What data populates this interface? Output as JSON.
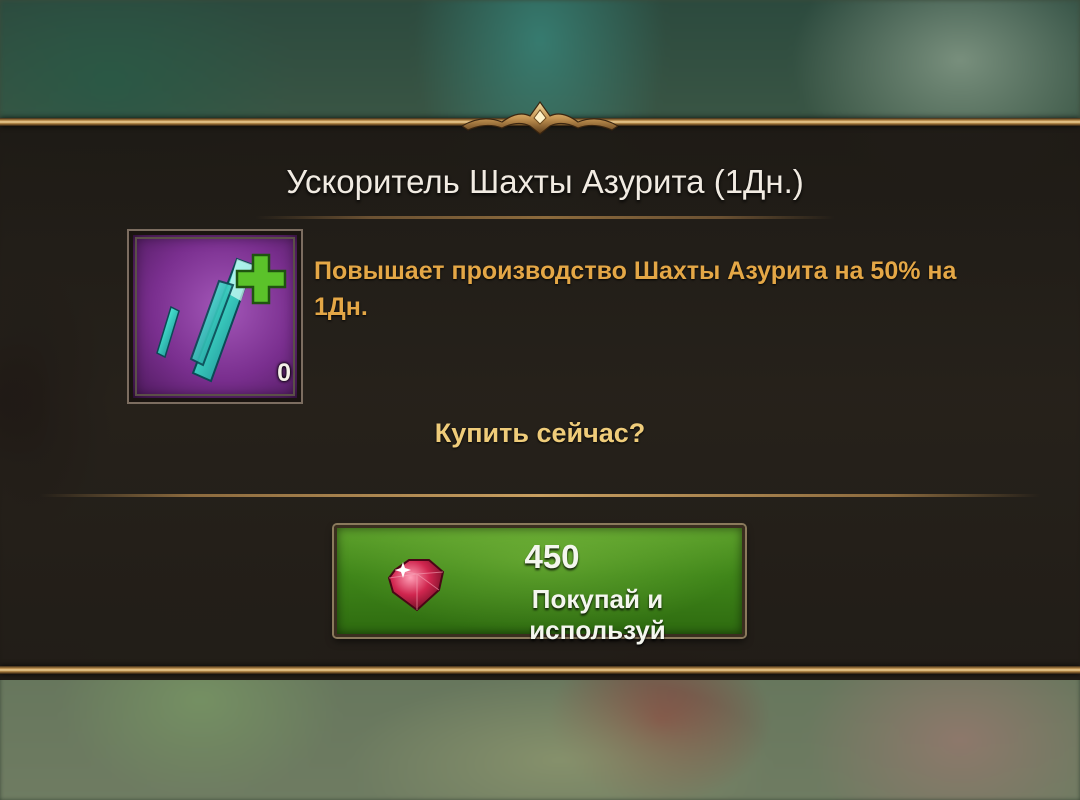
{
  "dialog": {
    "title": "Ускоритель Шахты Азурита (1Дн.)",
    "description": "Повышает производство Шахты Азурита на 50% на 1Дн.",
    "question": "Купить сейчас?"
  },
  "item": {
    "icon": "azurite-boost-crystal-icon",
    "count": "0"
  },
  "buy_button": {
    "price": "450",
    "label": "Покупай и используй",
    "currency_icon": "ruby-gem-icon"
  },
  "colors": {
    "title_text": "#f1ebe2",
    "description_text": "#e4a746",
    "question_text": "#efcc7a",
    "button_green": "#3f8519",
    "frame_gold": "#c9a061",
    "item_bg_purple": "#7a2f8f"
  }
}
